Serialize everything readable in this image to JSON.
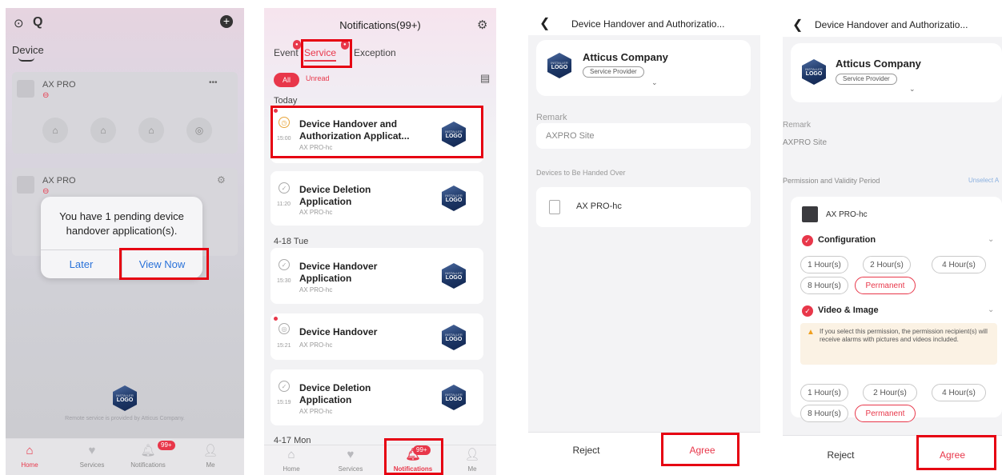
{
  "home": {
    "device_title": "Device",
    "devices": [
      {
        "name": "AX PRO"
      },
      {
        "name": "AX PRO"
      }
    ],
    "more_glyph": "•••",
    "dialog": {
      "message": "You have 1 pending device handover application(s).",
      "later": "Later",
      "view_now": "View Now"
    },
    "footer_text": "Remote service is provided by Atticus Company.",
    "tabs": [
      "Home",
      "Services",
      "Notifications",
      "Me"
    ],
    "badge": "99+"
  },
  "notifications": {
    "title": "Notifications(99+)",
    "tabs": [
      "Event",
      "Service",
      "Exception"
    ],
    "filters": {
      "all": "All",
      "unread": "Unread"
    },
    "sections": {
      "today": "Today",
      "tue": "4-18 Tue",
      "mon": "4-17 Mon"
    },
    "items": [
      {
        "title_line1": "Device Handover and",
        "title_line2": "Authorization Applicat...",
        "time": "15:00",
        "device": "AX PRO-hc"
      },
      {
        "title_line1": "Device Deletion",
        "title_line2": "Application",
        "time": "11:20",
        "device": "AX PRO-hc"
      },
      {
        "title_line1": "Device Handover",
        "title_line2": "Application",
        "time": "15:30",
        "device": "AX PRO-hc"
      },
      {
        "title_line1": "Device Handover",
        "title_line2": "",
        "time": "15:21",
        "device": "AX PRO-hc"
      },
      {
        "title_line1": "Device Deletion",
        "title_line2": "Application",
        "time": "15:19",
        "device": "AX PRO-hc"
      }
    ],
    "tabs_bottom": [
      "Home",
      "Services",
      "Notifications",
      "Me"
    ],
    "badge": "99+"
  },
  "handover": {
    "title": "Device Handover and Authorizatio...",
    "company": "Atticus Company",
    "role": "Service Provider",
    "remark_label": "Remark",
    "remark_value": "AXPRO Site",
    "devices_label": "Devices to Be Handed Over",
    "device": "AX PRO-hc",
    "reject": "Reject",
    "agree": "Agree"
  },
  "permissions": {
    "title": "Device Handover and Authorizatio...",
    "company": "Atticus Company",
    "role": "Service Provider",
    "remark_label": "Remark",
    "remark_value": "AXPRO Site",
    "perm_label": "Permission and Validity Period",
    "unselect": "Unselect A",
    "device": "AX PRO-hc",
    "configuration": "Configuration",
    "video": "Video & Image",
    "durations": [
      "1 Hour(s)",
      "2 Hour(s)",
      "4 Hour(s)",
      "8 Hour(s)",
      "Permanent"
    ],
    "warning": "If you select this permission, the permission recipient(s) will receive alarms with pictures and videos included.",
    "reject": "Reject",
    "agree": "Agree"
  },
  "logo": {
    "line1": "INSTALLER",
    "line2": "LOGO"
  },
  "colors": {
    "accent": "#e8374a",
    "highlight": "#e60012",
    "link": "#2a72d9"
  }
}
